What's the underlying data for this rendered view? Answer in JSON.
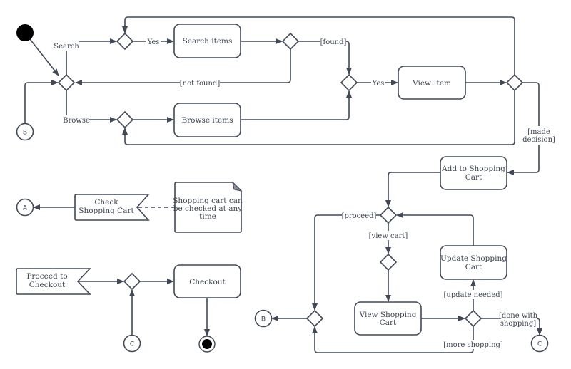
{
  "diagram": {
    "type": "UML activity diagram",
    "colors": {
      "stroke": "#414956",
      "text": "#3c4350",
      "fill": "#ffffff",
      "initial": "#000000"
    },
    "actions": {
      "search_items": "Search items",
      "browse_items": "Browse items",
      "view_item": "View Item",
      "add_to_cart_1": "Add to Shopping",
      "add_to_cart_2": "Cart",
      "update_cart_1": "Update Shopping",
      "update_cart_2": "Cart",
      "view_cart_1": "View Shopping",
      "view_cart_2": "Cart",
      "checkout": "Checkout"
    },
    "signals": {
      "check_cart_1": "Check",
      "check_cart_2": "Shopping Cart",
      "proceed_1": "Proceed to",
      "proceed_2": "Checkout"
    },
    "note": {
      "line1": "Shopping cart can",
      "line2": "be checked at any",
      "line3": "time"
    },
    "connectors": {
      "a": "A",
      "b": "B",
      "c": "C"
    },
    "edge_labels": {
      "search": "Search",
      "browse": "Browse",
      "yes_1": "Yes",
      "yes_2": "Yes",
      "found": "[found]",
      "not_found": "[not found]",
      "made_decision_1": "[made",
      "made_decision_2": "decision]",
      "proceed": "[proceed]",
      "view_cart": "[view cart]",
      "update_needed": "[update needed]",
      "done_1": "[done with",
      "done_2": "shopping]",
      "more_shopping": "[more shopping]"
    }
  }
}
